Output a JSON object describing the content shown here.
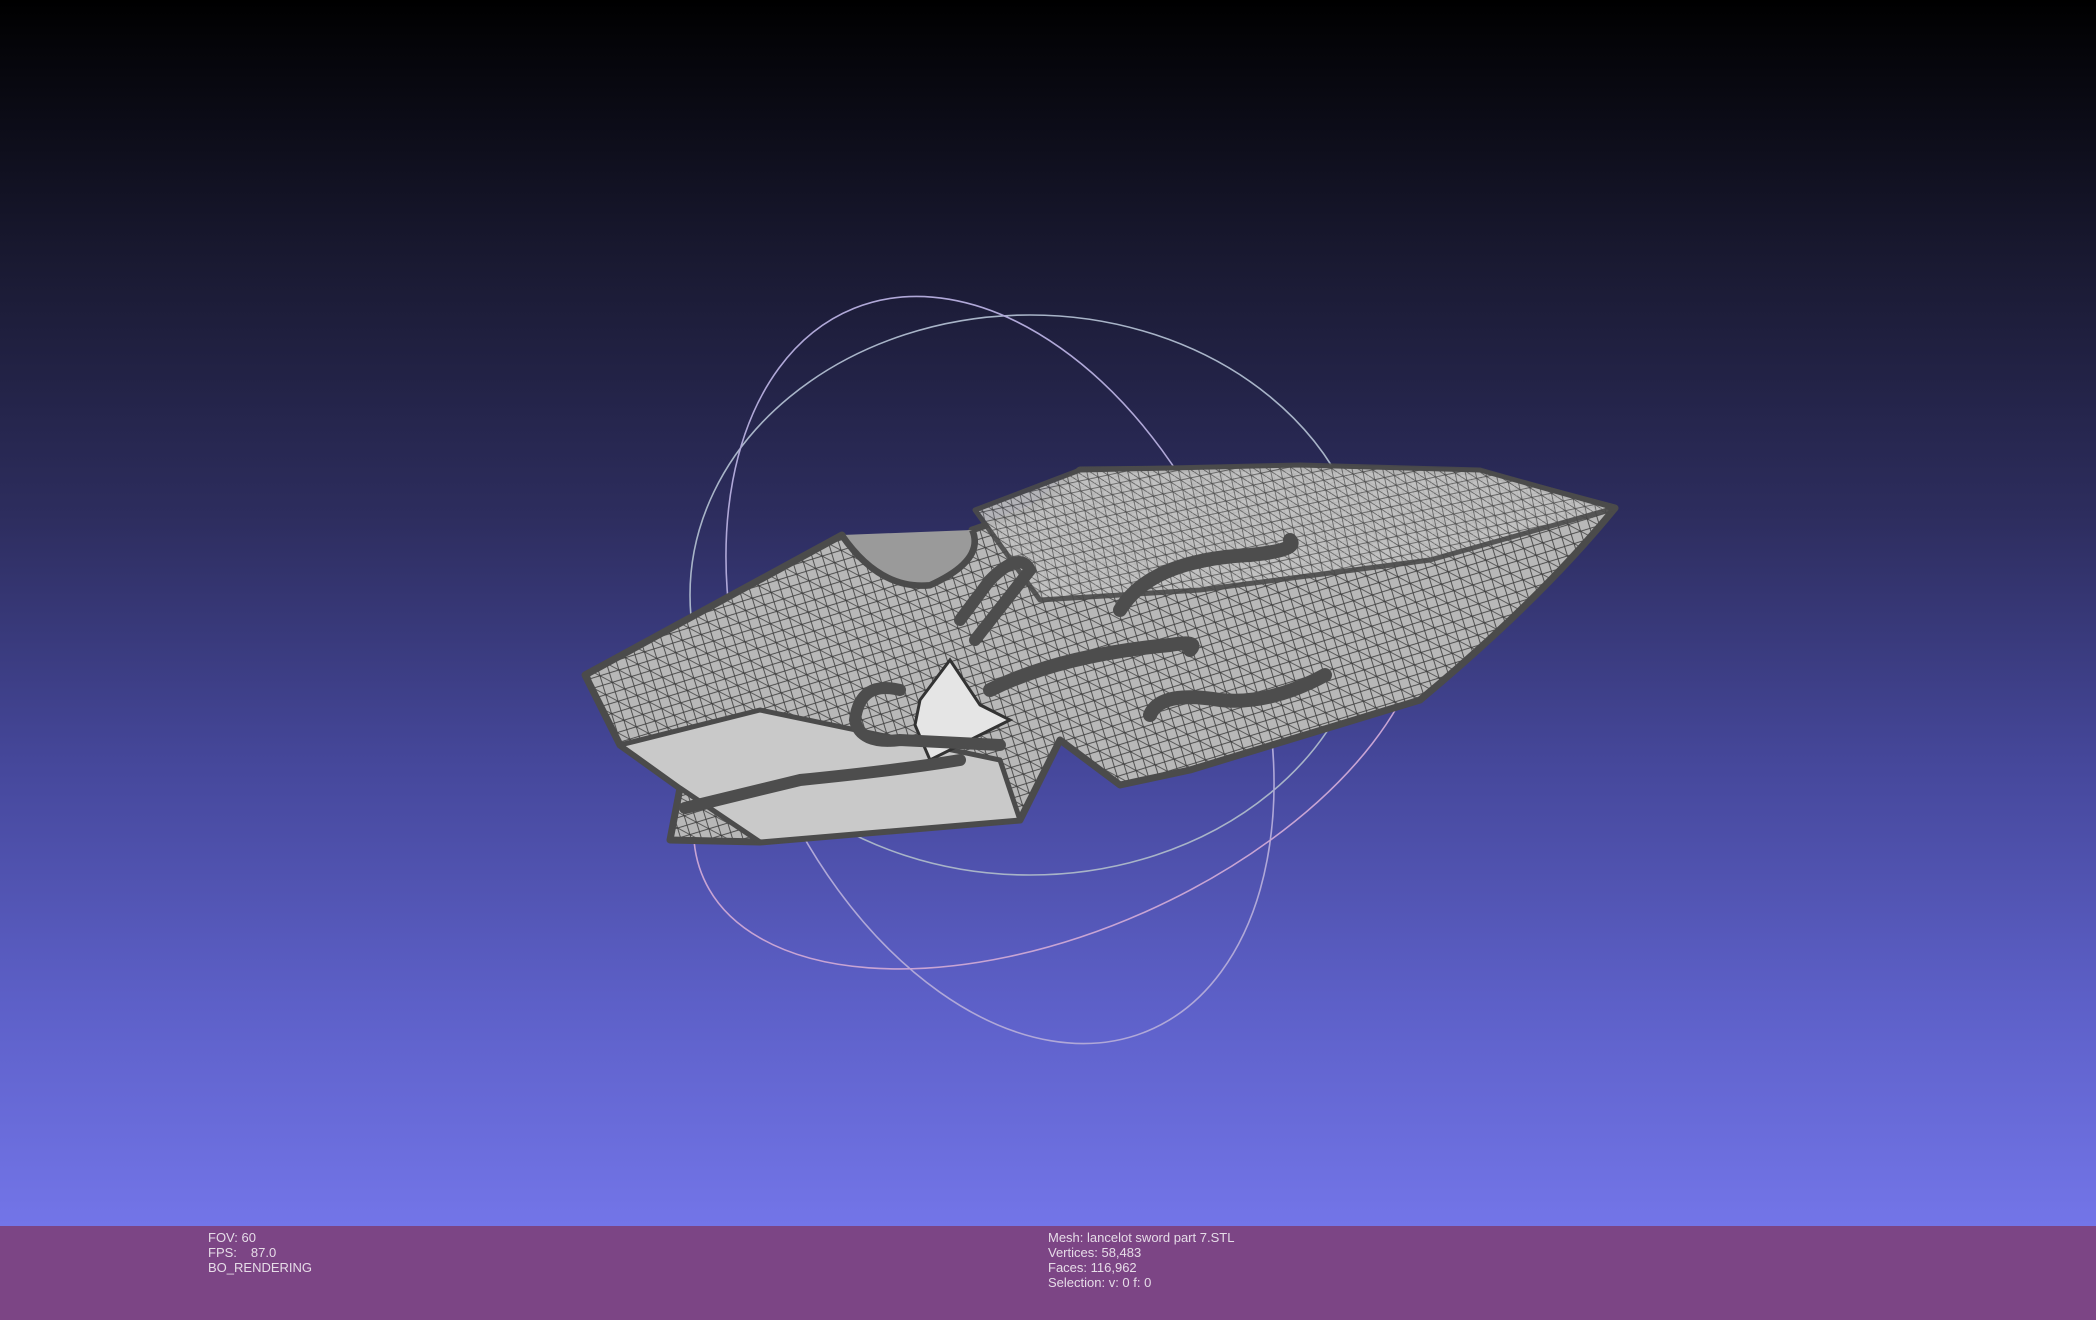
{
  "viewer": {
    "left_info": {
      "fov": "FOV: 60",
      "fps_label": "FPS:",
      "fps_value": "87.0",
      "render_mode": "BO_RENDERING"
    },
    "right_info": {
      "mesh": "Mesh: lancelot sword part 7.STL",
      "vertices": "Vertices: 58,483",
      "faces": "Faces: 116,962",
      "selection": "Selection: v: 0 f: 0"
    }
  },
  "colors": {
    "background_top": "#000000",
    "background_bottom": "#7375e8",
    "statusbar": "#7c4585",
    "mesh_fill": "#b4b4b4",
    "mesh_edge": "#4a4a4a",
    "trackball": "#b4b4d0"
  },
  "icons": [
    "trackball-gizmo",
    "mesh-model"
  ]
}
